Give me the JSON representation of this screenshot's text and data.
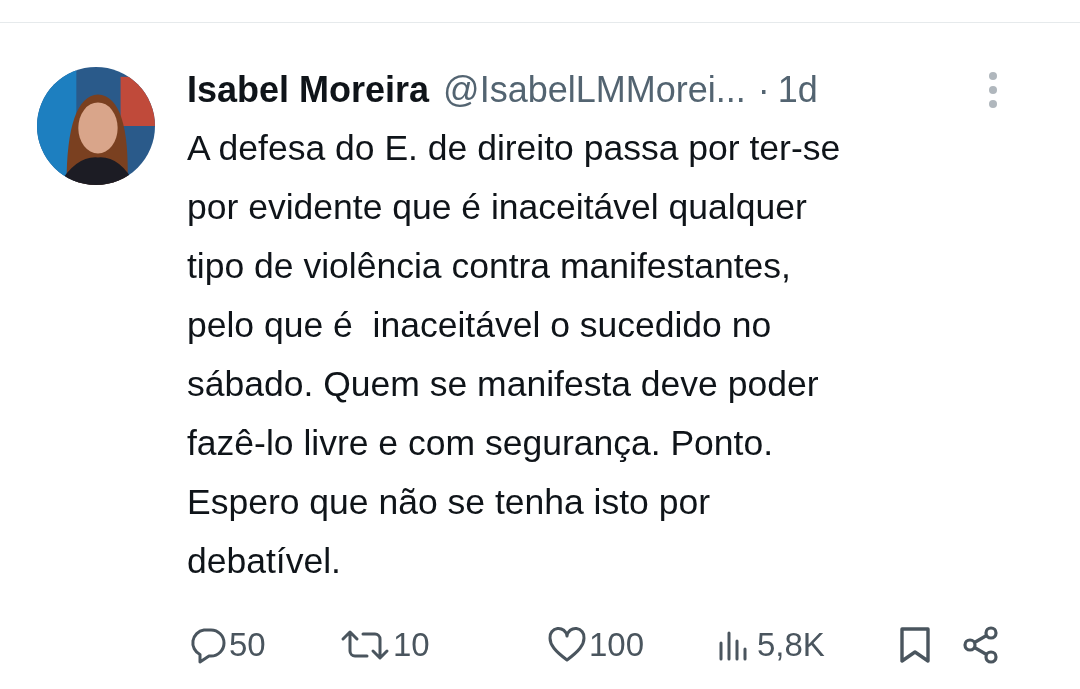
{
  "post": {
    "author": "Isabel Moreira",
    "handle": "@IsabelLMMorei...",
    "separator": "·",
    "time": "1d",
    "body": "A defesa do E. de direito passa por ter-se\npor evidente que é inaceitável qualquer\ntipo de violência contra manifestantes,\npelo que é  inaceitável o sucedido no\nsábado. Quem se manifesta deve poder\nfazê-lo livre e com segurança. Ponto.\nEspero que não se tenha isto por\ndebatível."
  },
  "actions": [
    {
      "kind": "reply",
      "count": "50"
    },
    {
      "kind": "repost",
      "count": "10"
    },
    {
      "kind": "like",
      "count": "100"
    },
    {
      "kind": "views",
      "count": "5,8K"
    },
    {
      "kind": "bookmark"
    },
    {
      "kind": "share"
    }
  ]
}
